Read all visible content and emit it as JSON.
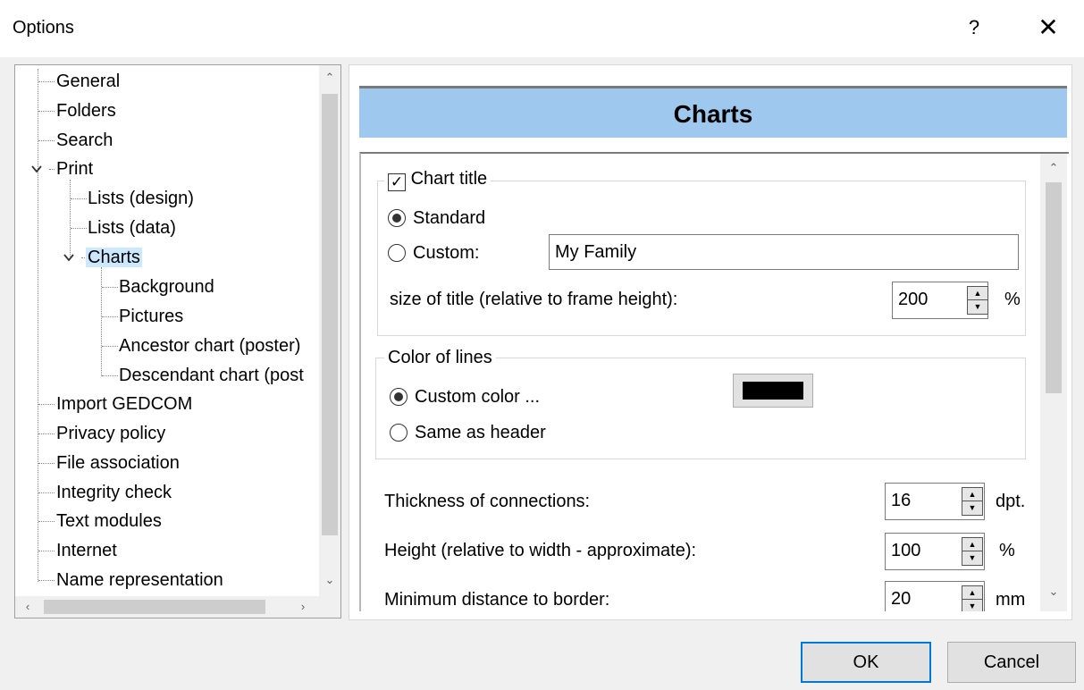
{
  "window": {
    "title": "Options",
    "help_label": "?",
    "close_label": "✕"
  },
  "tree": {
    "items": [
      {
        "label": "General"
      },
      {
        "label": "Folders"
      },
      {
        "label": "Search"
      },
      {
        "label": "Print"
      },
      {
        "label": "Lists (design)"
      },
      {
        "label": "Lists (data)"
      },
      {
        "label": "Charts"
      },
      {
        "label": "Background"
      },
      {
        "label": "Pictures"
      },
      {
        "label": "Ancestor chart (poster)"
      },
      {
        "label": "Descendant chart (post"
      },
      {
        "label": "Import GEDCOM"
      },
      {
        "label": "Privacy policy"
      },
      {
        "label": "File association"
      },
      {
        "label": "Integrity check"
      },
      {
        "label": "Text modules"
      },
      {
        "label": "Internet"
      },
      {
        "label": "Name representation"
      }
    ],
    "selected": "Charts"
  },
  "panel": {
    "header": "Charts",
    "chart_title": {
      "checkbox_label": "Chart title",
      "checked": true,
      "standard_label": "Standard",
      "custom_label": "Custom:",
      "selected_option": "Standard",
      "custom_value": "My Family",
      "size_label": "size of title (relative to frame height):",
      "size_value": "200",
      "size_unit": "%"
    },
    "color_of_lines": {
      "legend": "Color of lines",
      "custom_color_label": "Custom color ...",
      "same_as_header_label": "Same as header",
      "selected_option": "Custom color ...",
      "color": "#000000"
    },
    "thickness": {
      "label": "Thickness of connections:",
      "value": "16",
      "unit": "dpt."
    },
    "height": {
      "label": "Height (relative to width - approximate):",
      "value": "100",
      "unit": "%"
    },
    "min_distance": {
      "label": "Minimum distance to border:",
      "value": "20",
      "unit": "mm"
    }
  },
  "buttons": {
    "ok": "OK",
    "cancel": "Cancel"
  },
  "colors": {
    "header_bg": "#9fc8ef",
    "selection_bg": "#cce8ff",
    "default_button_border": "#0078d7"
  }
}
